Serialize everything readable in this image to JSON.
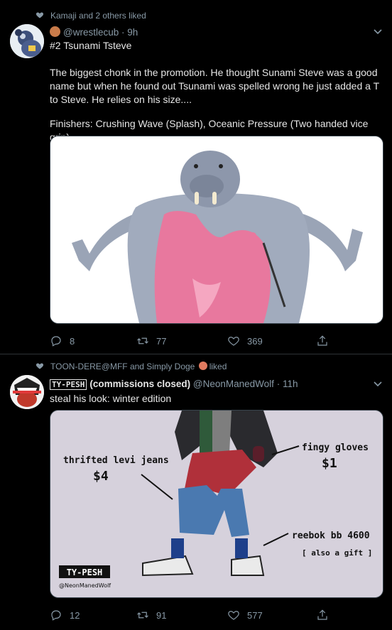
{
  "tweets": [
    {
      "social_context": "Kamaji and 2 others liked",
      "handle": "@wrestlecub",
      "time": "9h",
      "title": "#2 Tsunami Tsteve",
      "body_p1": "The biggest chonk in the promotion. He thought Sunami Steve was a good name but when he found out Tsunami was spelled wrong he just added a T to Steve. He relies on his size....",
      "body_p2": "Finishers: Crushing Wave (Splash), Oceanic Pressure (Two handed vice grip)",
      "replies": "8",
      "retweets": "77",
      "likes": "369"
    },
    {
      "social_context": "TOON-DERE@MFF and Simply Doge",
      "social_suffix": "liked",
      "display_name_badge": "TY-PESH",
      "display_name": "(commissions closed)",
      "handle": "@NeonManedWolf",
      "time": "11h",
      "body": "steal his look: winter edition",
      "art_labels": {
        "jeans": "thrifted levi jeans",
        "jeans_price": "$4",
        "gloves": "fingy gloves",
        "gloves_price": "$1",
        "shoes": "reebok bb 4600",
        "shoes_note": "[ also a gift ]",
        "logo": "TY-PESH",
        "logo_handle": "@NeonManedWolf"
      },
      "replies": "12",
      "retweets": "91",
      "likes": "577"
    }
  ],
  "icons": {
    "like": "heart-icon",
    "reply": "reply-icon",
    "retweet": "retweet-icon",
    "share": "share-icon",
    "caret": "chevron-down-icon"
  },
  "colors": {
    "background": "#000000",
    "muted": "#8899a6",
    "text": "#e6e6e6",
    "divider": "#2f3336"
  }
}
